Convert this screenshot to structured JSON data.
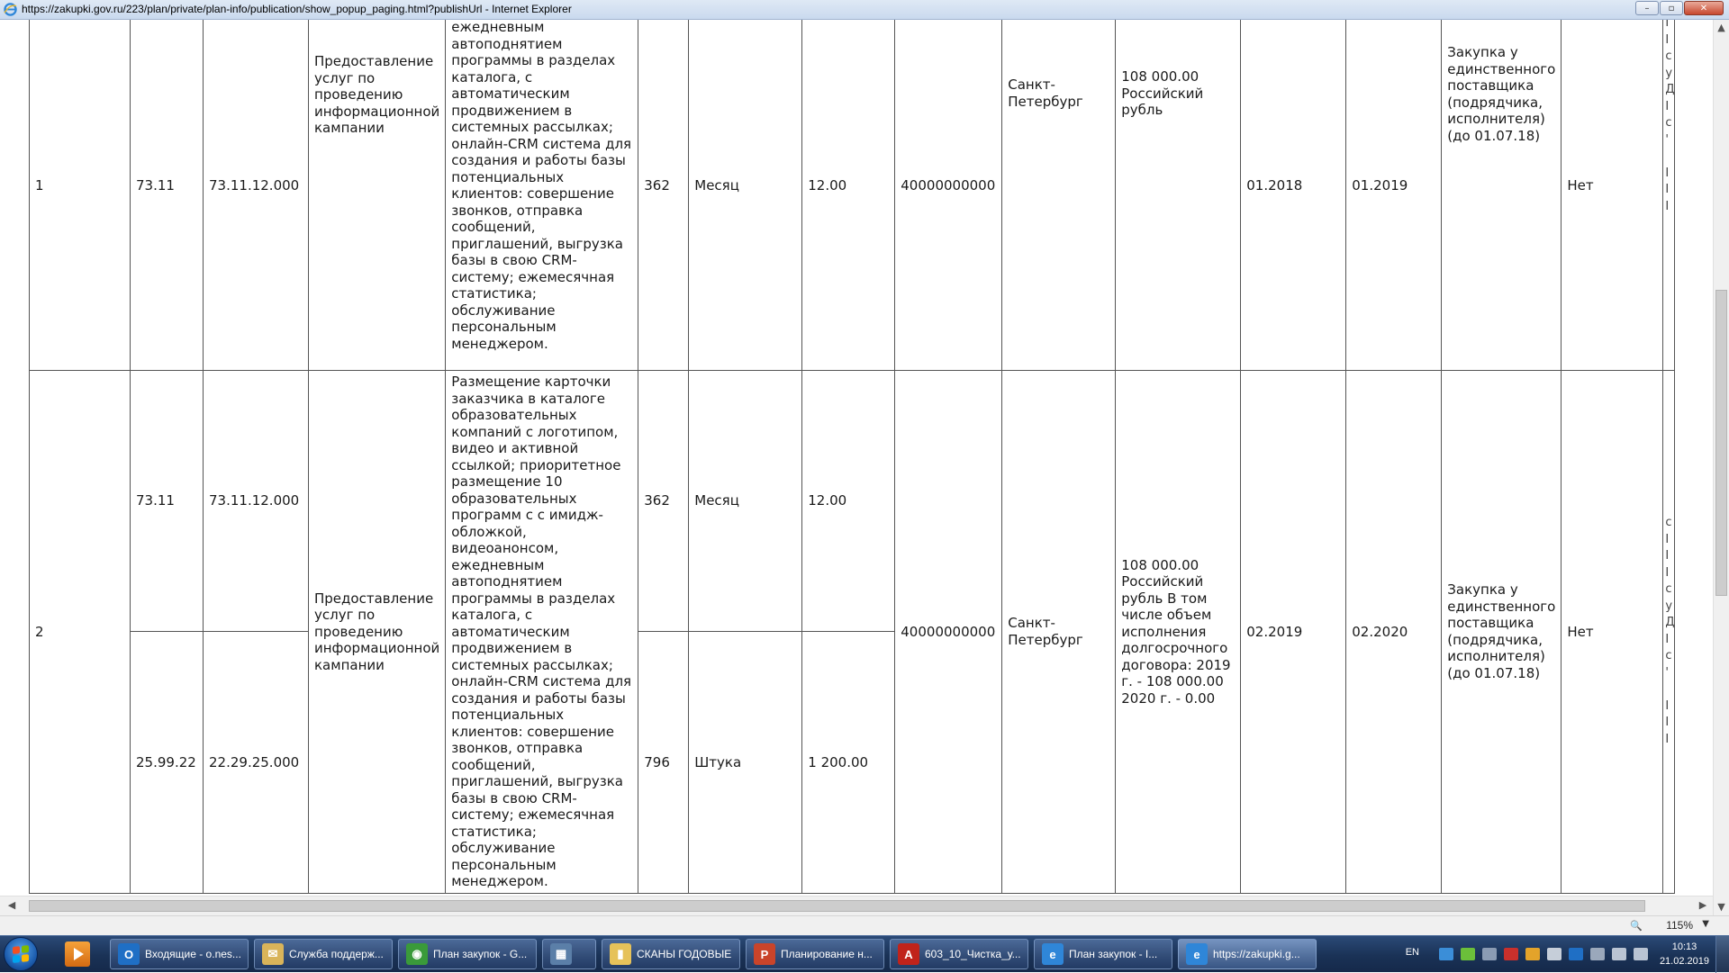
{
  "window": {
    "title": "https://zakupki.gov.ru/223/plan/private/plan-info/publication/show_popup_paging.html?publishUrl - Internet Explorer",
    "min_label": "–",
    "max_label": "▫",
    "close_label": "✕"
  },
  "table": {
    "rows": [
      {
        "num": "1",
        "okved": "73.11",
        "okpd": "73.11.12.000",
        "subject": "Предоставление услуг по проведению информационной кампании",
        "description": "ежедневным автоподнятием программы в разделах каталога, с автоматическим продвижением в системных рассылках; онлайн-CRM система для создания и работы базы потенциальных клиентов: совершение звонков, отправка сообщений, приглашений, выгрузка базы в свою CRM-систему; ежемесячная статистика; обслуживание персональным менеджером.",
        "okei_code": "362",
        "unit": "Месяц",
        "quantity": "12.00",
        "okato": "40000000000",
        "region": "Санкт-Петербург",
        "price": "108 000.00 Российский рубль",
        "start": "01.2018",
        "end": "01.2019",
        "method": "Закупка у единственного поставщика (подрядчика, исполнителя) (до 01.07.18)",
        "electronic": "Нет",
        "extra": "І\nІ\nс\nу\nД\nІ\nс\n'\n \nІ\nІ\nІ"
      },
      {
        "num": "2",
        "subject": "Предоставление услуг по проведению информационной кампании",
        "description": "Размещение карточки заказчика в каталоге образовательных компаний с логотипом, видео и активной ссылкой; приоритетное размещение 10 образовательных программ с с имидж-обложкой, видеоанонсом, ежедневным автоподнятием программы в разделах каталога, с автоматическим продвижением в системных рассылках; онлайн-CRM система для создания и работы базы потенциальных клиентов: совершение звонков, отправка сообщений, приглашений, выгрузка базы в свою CRM-систему; ежемесячная статистика; обслуживание персональным менеджером.",
        "okato": "40000000000",
        "region": "Санкт-Петербург",
        "price": "108 000.00 Российский рубль В том числе объем исполнения долгосрочного договора: 2019 г. - 108 000.00 2020 г. - 0.00",
        "start": "02.2019",
        "end": "02.2020",
        "method": "Закупка у единственного поставщика (подрядчика, исполнителя) (до 01.07.18)",
        "electronic": "Нет",
        "extra": "с\nІ\nІ\nІ\nс\nу\nД\nІ\nс\n'\n \nІ\nІ\nІ",
        "sub_a": {
          "okved": "73.11",
          "okpd": "73.11.12.000",
          "okei_code": "362",
          "unit": "Месяц",
          "quantity": "12.00"
        },
        "sub_b": {
          "okved": "25.99.22",
          "okpd": "22.29.25.000",
          "okei_code": "796",
          "unit": "Штука",
          "quantity": "1 200.00"
        }
      }
    ]
  },
  "statusbar": {
    "zoom": "115%"
  },
  "taskbar": {
    "items": [
      {
        "label": "Входящие - o.nes...",
        "icon": "outlook-icon",
        "color": "#1f6fc5",
        "glyph": "O"
      },
      {
        "label": "Служба поддерж...",
        "icon": "mail-icon",
        "color": "#d9b45a",
        "glyph": "✉"
      },
      {
        "label": "План закупок - G...",
        "icon": "chrome-icon",
        "color": "#3a9a3a",
        "glyph": "◉"
      },
      {
        "label": "",
        "icon": "calculator-icon",
        "color": "#5b7fa8",
        "glyph": "▦"
      },
      {
        "label": "СКАНЫ ГОДОВЫЕ",
        "icon": "folder-icon",
        "color": "#e6c25a",
        "glyph": "▮"
      },
      {
        "label": "Планирование н...",
        "icon": "powerpoint-icon",
        "color": "#c9442a",
        "glyph": "P"
      },
      {
        "label": "603_10_Чистка_у...",
        "icon": "pdf-icon",
        "color": "#c0231b",
        "glyph": "A"
      },
      {
        "label": "План закупок - I...",
        "icon": "ie-icon",
        "color": "#2f86d8",
        "glyph": "e"
      },
      {
        "label": "https://zakupki.g...",
        "icon": "ie-icon",
        "color": "#2f86d8",
        "glyph": "e"
      }
    ],
    "lang": "EN",
    "time": "10:13",
    "date": "21.02.2019"
  }
}
